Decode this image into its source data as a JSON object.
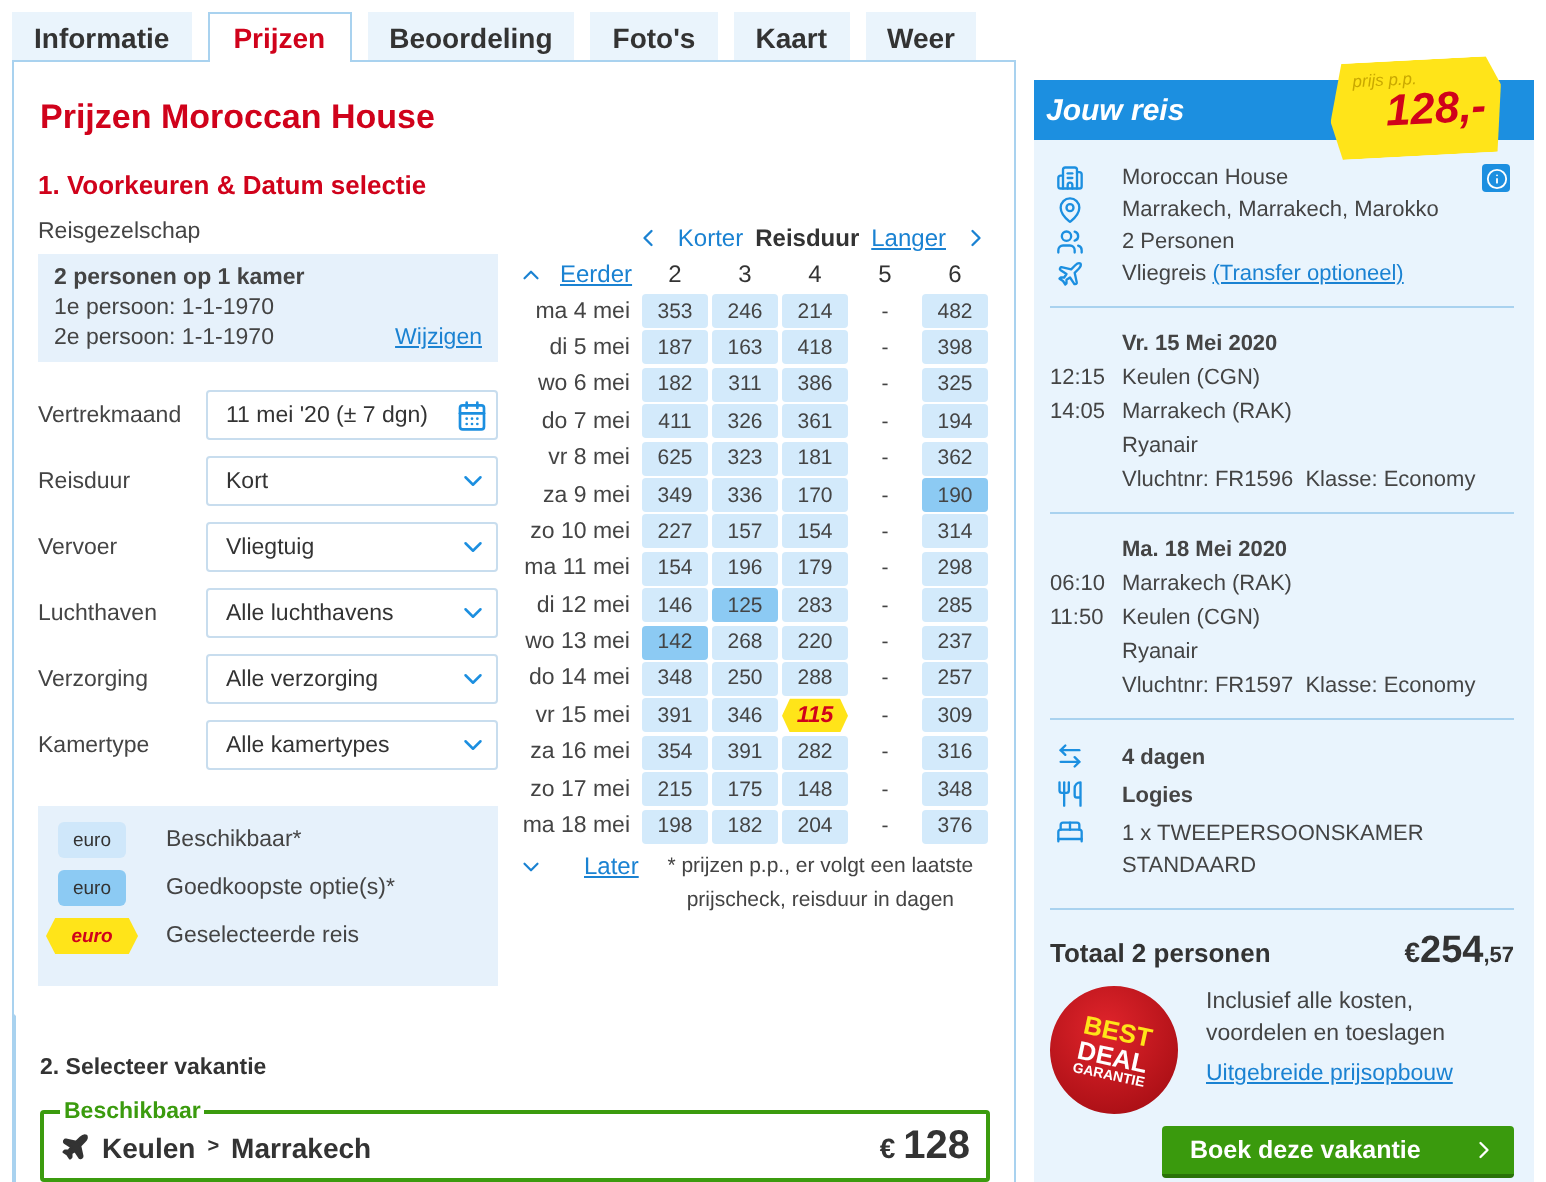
{
  "tabs": [
    {
      "label": "Informatie",
      "selected": false
    },
    {
      "label": "Prijzen",
      "selected": true
    },
    {
      "label": "Beoordeling",
      "selected": false
    },
    {
      "label": "Foto's",
      "selected": false
    },
    {
      "label": "Kaart",
      "selected": false
    },
    {
      "label": "Weer",
      "selected": false
    }
  ],
  "title": "Prijzen Moroccan House",
  "section1": "1. Voorkeuren & Datum selectie",
  "party": {
    "label": "Reisgezelschap",
    "summary": "2 personen op 1 kamer",
    "lines": [
      "1e persoon: 1-1-1970",
      "2e persoon: 1-1-1970"
    ],
    "change_link": "Wijzigen"
  },
  "fields": [
    {
      "label": "Vertrekmaand",
      "value": "11 mei '20 (± 7 dgn)",
      "kind": "date"
    },
    {
      "label": "Reisduur",
      "value": "Kort",
      "kind": "select"
    },
    {
      "label": "Vervoer",
      "value": "Vliegtuig",
      "kind": "select"
    },
    {
      "label": "Luchthaven",
      "value": "Alle luchthavens",
      "kind": "select"
    },
    {
      "label": "Verzorging",
      "value": "Alle verzorging",
      "kind": "select"
    },
    {
      "label": "Kamertype",
      "value": "Alle kamertypes",
      "kind": "select"
    }
  ],
  "legend": [
    {
      "kind": "available",
      "swatch": "euro",
      "label": "Beschikbaar*"
    },
    {
      "kind": "cheapest",
      "swatch": "euro",
      "label": "Goedkoopste optie(s)*"
    },
    {
      "kind": "selected",
      "swatch": "euro",
      "label": "Geselecteerde reis"
    }
  ],
  "grid": {
    "shorter": "Korter",
    "duration_label": "Reisduur",
    "longer": "Langer",
    "earlier": "Eerder",
    "later": "Later",
    "columns": [
      "2",
      "3",
      "4",
      "5",
      "6"
    ],
    "rows": [
      {
        "date": "ma 4 mei",
        "cells": [
          {
            "price": "353",
            "kind": "available"
          },
          {
            "price": "246",
            "kind": "available"
          },
          {
            "price": "214",
            "kind": "available"
          },
          {
            "price": "-",
            "kind": "none"
          },
          {
            "price": "482",
            "kind": "available"
          }
        ]
      },
      {
        "date": "di 5 mei",
        "cells": [
          {
            "price": "187",
            "kind": "available"
          },
          {
            "price": "163",
            "kind": "available"
          },
          {
            "price": "418",
            "kind": "available"
          },
          {
            "price": "-",
            "kind": "none"
          },
          {
            "price": "398",
            "kind": "available"
          }
        ]
      },
      {
        "date": "wo 6 mei",
        "cells": [
          {
            "price": "182",
            "kind": "available"
          },
          {
            "price": "311",
            "kind": "available"
          },
          {
            "price": "386",
            "kind": "available"
          },
          {
            "price": "-",
            "kind": "none"
          },
          {
            "price": "325",
            "kind": "available"
          }
        ]
      },
      {
        "date": "do 7 mei",
        "cells": [
          {
            "price": "411",
            "kind": "available"
          },
          {
            "price": "326",
            "kind": "available"
          },
          {
            "price": "361",
            "kind": "available"
          },
          {
            "price": "-",
            "kind": "none"
          },
          {
            "price": "194",
            "kind": "available"
          }
        ]
      },
      {
        "date": "vr 8 mei",
        "cells": [
          {
            "price": "625",
            "kind": "available"
          },
          {
            "price": "323",
            "kind": "available"
          },
          {
            "price": "181",
            "kind": "available"
          },
          {
            "price": "-",
            "kind": "none"
          },
          {
            "price": "362",
            "kind": "available"
          }
        ]
      },
      {
        "date": "za 9 mei",
        "cells": [
          {
            "price": "349",
            "kind": "available"
          },
          {
            "price": "336",
            "kind": "available"
          },
          {
            "price": "170",
            "kind": "available"
          },
          {
            "price": "-",
            "kind": "none"
          },
          {
            "price": "190",
            "kind": "cheapest"
          }
        ]
      },
      {
        "date": "zo 10 mei",
        "cells": [
          {
            "price": "227",
            "kind": "available"
          },
          {
            "price": "157",
            "kind": "available"
          },
          {
            "price": "154",
            "kind": "available"
          },
          {
            "price": "-",
            "kind": "none"
          },
          {
            "price": "314",
            "kind": "available"
          }
        ]
      },
      {
        "date": "ma 11 mei",
        "cells": [
          {
            "price": "154",
            "kind": "available"
          },
          {
            "price": "196",
            "kind": "available"
          },
          {
            "price": "179",
            "kind": "available"
          },
          {
            "price": "-",
            "kind": "none"
          },
          {
            "price": "298",
            "kind": "available"
          }
        ]
      },
      {
        "date": "di 12 mei",
        "cells": [
          {
            "price": "146",
            "kind": "available"
          },
          {
            "price": "125",
            "kind": "cheapest"
          },
          {
            "price": "283",
            "kind": "available"
          },
          {
            "price": "-",
            "kind": "none"
          },
          {
            "price": "285",
            "kind": "available"
          }
        ]
      },
      {
        "date": "wo 13 mei",
        "cells": [
          {
            "price": "142",
            "kind": "cheapest"
          },
          {
            "price": "268",
            "kind": "available"
          },
          {
            "price": "220",
            "kind": "available"
          },
          {
            "price": "-",
            "kind": "none"
          },
          {
            "price": "237",
            "kind": "available"
          }
        ]
      },
      {
        "date": "do 14 mei",
        "cells": [
          {
            "price": "348",
            "kind": "available"
          },
          {
            "price": "250",
            "kind": "available"
          },
          {
            "price": "288",
            "kind": "available"
          },
          {
            "price": "-",
            "kind": "none"
          },
          {
            "price": "257",
            "kind": "available"
          }
        ]
      },
      {
        "date": "vr 15 mei",
        "cells": [
          {
            "price": "391",
            "kind": "available"
          },
          {
            "price": "346",
            "kind": "available"
          },
          {
            "price": "115",
            "kind": "selected"
          },
          {
            "price": "-",
            "kind": "none"
          },
          {
            "price": "309",
            "kind": "available"
          }
        ]
      },
      {
        "date": "za 16 mei",
        "cells": [
          {
            "price": "354",
            "kind": "available"
          },
          {
            "price": "391",
            "kind": "available"
          },
          {
            "price": "282",
            "kind": "available"
          },
          {
            "price": "-",
            "kind": "none"
          },
          {
            "price": "316",
            "kind": "available"
          }
        ]
      },
      {
        "date": "zo 17 mei",
        "cells": [
          {
            "price": "215",
            "kind": "available"
          },
          {
            "price": "175",
            "kind": "available"
          },
          {
            "price": "148",
            "kind": "available"
          },
          {
            "price": "-",
            "kind": "none"
          },
          {
            "price": "348",
            "kind": "available"
          }
        ]
      },
      {
        "date": "ma 18 mei",
        "cells": [
          {
            "price": "198",
            "kind": "available"
          },
          {
            "price": "182",
            "kind": "available"
          },
          {
            "price": "204",
            "kind": "available"
          },
          {
            "price": "-",
            "kind": "none"
          },
          {
            "price": "376",
            "kind": "available"
          }
        ]
      }
    ],
    "footnote": "* prijzen p.p., er volgt een laatste prijscheck, reisduur in dagen"
  },
  "section2": {
    "title": "2. Selecteer vakantie",
    "group_label": "Beschikbaar",
    "from": "Keulen",
    "separator": ">",
    "to": "Marrakech",
    "currency": "€",
    "price": "128"
  },
  "trip": {
    "title": "Jouw reis",
    "price_caption": "prijs p.p.",
    "price": "128,-",
    "summary": [
      {
        "kind": "hotel",
        "text": "Moroccan House"
      },
      {
        "kind": "location",
        "text": "Marrakech, Marrakech, Marokko"
      },
      {
        "kind": "persons",
        "text": "2 Personen"
      },
      {
        "kind": "flight",
        "text": "Vliegreis",
        "link": "(Transfer optioneel)"
      }
    ],
    "flights": [
      {
        "date": "Vr. 15 Mei 2020",
        "legs": [
          {
            "time": "12:15",
            "place": "Keulen (CGN)"
          },
          {
            "time": "14:05",
            "place": "Marrakech (RAK)"
          }
        ],
        "airline": "Ryanair",
        "info": "Vluchtnr: FR1596  Klasse: Economy"
      },
      {
        "date": "Ma. 18 Mei 2020",
        "legs": [
          {
            "time": "06:10",
            "place": "Marrakech (RAK)"
          },
          {
            "time": "11:50",
            "place": "Keulen (CGN)"
          }
        ],
        "airline": "Ryanair",
        "info": "Vluchtnr: FR1597  Klasse: Economy"
      }
    ],
    "extras": [
      {
        "kind": "duration",
        "text": "4 dagen",
        "bold": true
      },
      {
        "kind": "board",
        "text": "Logies",
        "bold": true
      },
      {
        "kind": "room",
        "text": "1 x TWEEPERSOONSKAMER STANDAARD",
        "bold": false
      }
    ],
    "total_label": "Totaal 2 personen",
    "total_currency": "€",
    "total_whole": "254",
    "total_cents": ",57",
    "badge": [
      "BEST",
      "DEAL",
      "GARANTIE"
    ],
    "included": "Inclusief alle kosten, voordelen en toeslagen",
    "breakdown_link": "Uitgebreide prijsopbouw",
    "book_button": "Boek deze vakantie"
  }
}
